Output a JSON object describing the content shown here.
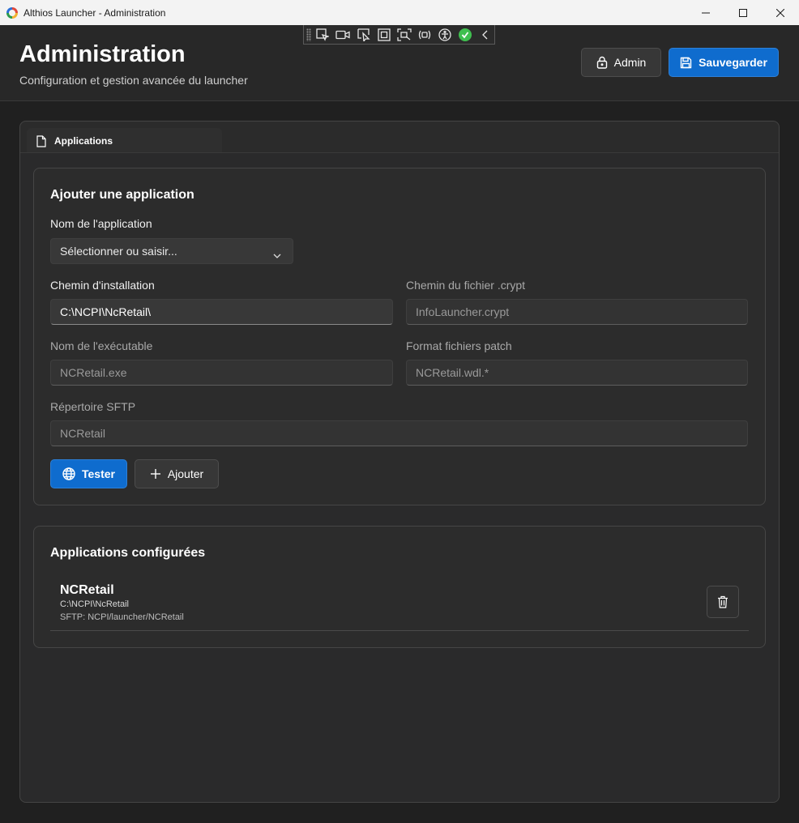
{
  "window": {
    "title": "Althios Launcher - Administration"
  },
  "debug_toolbar": {
    "icons": [
      "select-element-icon",
      "record-icon",
      "pointer-icon",
      "frame-icon",
      "layout-icon",
      "binding-icon",
      "accessibility-icon",
      "check-icon",
      "collapse-icon"
    ]
  },
  "header": {
    "title": "Administration",
    "subtitle": "Configuration et gestion avancée du launcher",
    "admin_label": "Admin",
    "save_label": "Sauvegarder"
  },
  "tabs": [
    {
      "label": "Applications",
      "icon": "document-icon",
      "selected": true
    }
  ],
  "add_app": {
    "title": "Ajouter une application",
    "name_label": "Nom de l'application",
    "name_placeholder": "Sélectionner ou saisir...",
    "install_path_label": "Chemin d'installation",
    "install_path_value": "C:\\NCPI\\NcRetail\\",
    "crypt_label": "Chemin du fichier .crypt",
    "crypt_placeholder": "InfoLauncher.crypt",
    "exe_label": "Nom de l'exécutable",
    "exe_placeholder": "NCRetail.exe",
    "patch_label": "Format fichiers patch",
    "patch_placeholder": "NCRetail.wdl.*",
    "sftp_label": "Répertoire SFTP",
    "sftp_placeholder": "NCRetail",
    "test_label": "Tester",
    "add_label": "Ajouter"
  },
  "configured": {
    "title": "Applications configurées",
    "items": [
      {
        "name": "NCRetail",
        "path": "C:\\NCPI\\NcRetail",
        "sftp": "SFTP: NCPI/launcher/NCRetail"
      }
    ]
  },
  "colors": {
    "accent": "#0f6cce",
    "background": "#202020",
    "card": "#2c2c2c"
  }
}
